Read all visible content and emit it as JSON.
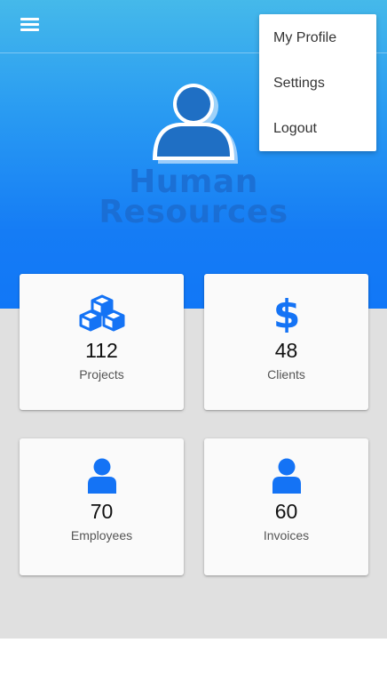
{
  "app": {
    "title_line1": "Human",
    "title_line2": "Resources"
  },
  "header": {
    "menu_icon": "hamburger-menu-icon"
  },
  "dropdown": {
    "items": [
      {
        "label": "My Profile"
      },
      {
        "label": "Settings"
      },
      {
        "label": "Logout"
      }
    ]
  },
  "cards": [
    {
      "icon": "cubes-icon",
      "count": "112",
      "label": "Projects"
    },
    {
      "icon": "dollar-icon",
      "count": "48",
      "label": "Clients"
    },
    {
      "icon": "user-icon",
      "count": "70",
      "label": "Employees"
    },
    {
      "icon": "user-icon",
      "count": "60",
      "label": "Invoices"
    }
  ],
  "colors": {
    "accent": "#1473f5",
    "hero_top": "#45b9ea",
    "hero_bottom": "#1177f7",
    "background": "#e0e0e0"
  }
}
